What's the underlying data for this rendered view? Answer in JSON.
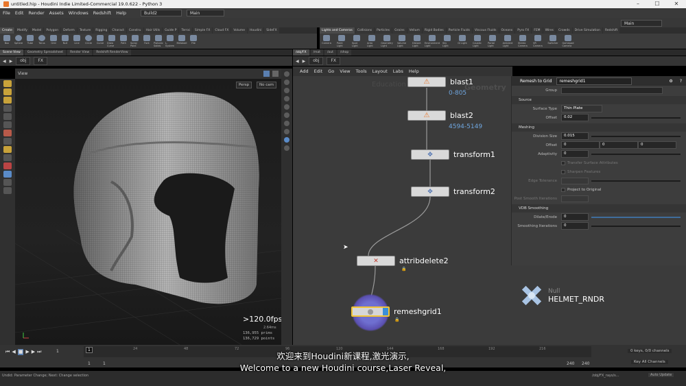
{
  "window": {
    "title": "untitled.hip - Houdini Indie Limited-Commercial 19.0.622 - Python 3",
    "controls": [
      "–",
      "☐",
      "✕"
    ]
  },
  "menu": {
    "items": [
      "File",
      "Edit",
      "Render",
      "Assets",
      "Windows",
      "Redshift",
      "Help"
    ],
    "build": "Build2",
    "desktop": "Main"
  },
  "shelf_left": {
    "tabs": [
      "Create",
      "Modify",
      "Model",
      "Polygon",
      "Deform",
      "Texture",
      "Rigging",
      "Charact",
      "Constru",
      "Hair Utils",
      "Guide P",
      "Terrai",
      "Simple FX",
      "Cloud FX",
      "Volume",
      "Houdini",
      "SideFX"
    ],
    "tools": [
      "Box",
      "Sphere",
      "Tube",
      "Torus",
      "Grid",
      "Null",
      "Line",
      "Circle",
      "Curve",
      "Draw Curve",
      "Path",
      "Spray Paint",
      "Font",
      "Platonic Solids",
      "L-System",
      "Metaball",
      "File"
    ]
  },
  "shelf_right": {
    "tabs": [
      "Lights and Cameras",
      "Collisions",
      "Particles",
      "Grains",
      "Vellum",
      "Rigid Bodies",
      "Particle Fluids",
      "Viscous Fluids",
      "Oceans",
      "Pyro FX",
      "FEM",
      "Wires",
      "Crowds",
      "Drive Simulation",
      "Redshift"
    ],
    "tools": [
      "Camera",
      "Point Light",
      "Spot Light",
      "Area Light",
      "Geometry Light",
      "Volume Light",
      "Distant Light",
      "Environment Light",
      "Sky Light",
      "GI Light",
      "Caustic Light",
      "Portal Light",
      "Ambient Light",
      "Stereo Camera",
      "VR Camera",
      "Switcher",
      "Gamepad Camera"
    ],
    "desktop": "Main"
  },
  "left_pane": {
    "tabs": [
      "Scene View",
      "Geometry Spreadsheet",
      "Render View",
      "Redshift RenderView"
    ],
    "path": [
      "obj",
      "FX"
    ],
    "view_label": "View",
    "persp": "Persp",
    "cam": "No cam",
    "fps": ">120.0fps",
    "ms": "2.64ms",
    "prims_value": "136,955",
    "prims_label": "prims",
    "points_value": "136,729",
    "points_label": "points"
  },
  "network": {
    "tabs": [
      "/obj/FX",
      "/mat",
      "/out",
      "/shop"
    ],
    "path": [
      "obj",
      "FX"
    ],
    "menu": [
      "Add",
      "Edit",
      "Go",
      "View",
      "Tools",
      "Layout",
      "Labs",
      "Help"
    ],
    "watermark_a": "Education",
    "watermark_b": "Geometry",
    "nodes": [
      {
        "name": "blast1",
        "info": "0-805"
      },
      {
        "name": "blast2",
        "info": "4594-5149"
      },
      {
        "name": "transform1",
        "info": ""
      },
      {
        "name": "transform2",
        "info": ""
      },
      {
        "name": "attribdelete2",
        "info": ""
      },
      {
        "name": "remeshgrid1",
        "info": ""
      }
    ],
    "null_type": "Null",
    "null_name": "HELMET_RNDR"
  },
  "params": {
    "type": "Remesh to Grid",
    "name": "remeshgrid1",
    "group_label": "Group",
    "source_label": "Source",
    "surface_type_label": "Surface Type",
    "surface_type": "Thin Plate",
    "offset_label": "Offset",
    "offset": "0.02",
    "meshing_label": "Meshing",
    "division_label": "Division Size",
    "division": "0.015",
    "offset2_label": "Offset",
    "offset2": [
      "0",
      "0",
      "0"
    ],
    "adaptivity_label": "Adaptivity",
    "adaptivity": "0",
    "transfer": "Transfer Surface Attributes",
    "sharpen": "Sharpen Features",
    "edge_tol_label": "Edge Tolerance",
    "project": "Project to Original",
    "post_smooth_label": "Post Smooth Iterations",
    "vdb_label": "VDB Smoothing",
    "dilate_label": "Dilate/Erode",
    "dilate": "0",
    "smoothing_label": "Smoothing Iterations",
    "smoothing": "0"
  },
  "timeline": {
    "frame": "1",
    "start": "1",
    "start2": "1",
    "end": "240",
    "end2": "240",
    "ticks": [
      "24",
      "48",
      "72",
      "96",
      "120",
      "144",
      "168",
      "192",
      "216"
    ],
    "keys": "0 keys, 0/0 channels",
    "key_all": "Key All Channels"
  },
  "status": {
    "message": "Undid: Parameter Change; Next: Change selection",
    "path": "/obj/FX_rays/s...",
    "auto_update": "Auto Update"
  },
  "subtitle": {
    "zh": "欢迎来到Houdini新课程,激光演示,",
    "en": "Welcome to a new Houdini course,Laser Reveal,"
  }
}
